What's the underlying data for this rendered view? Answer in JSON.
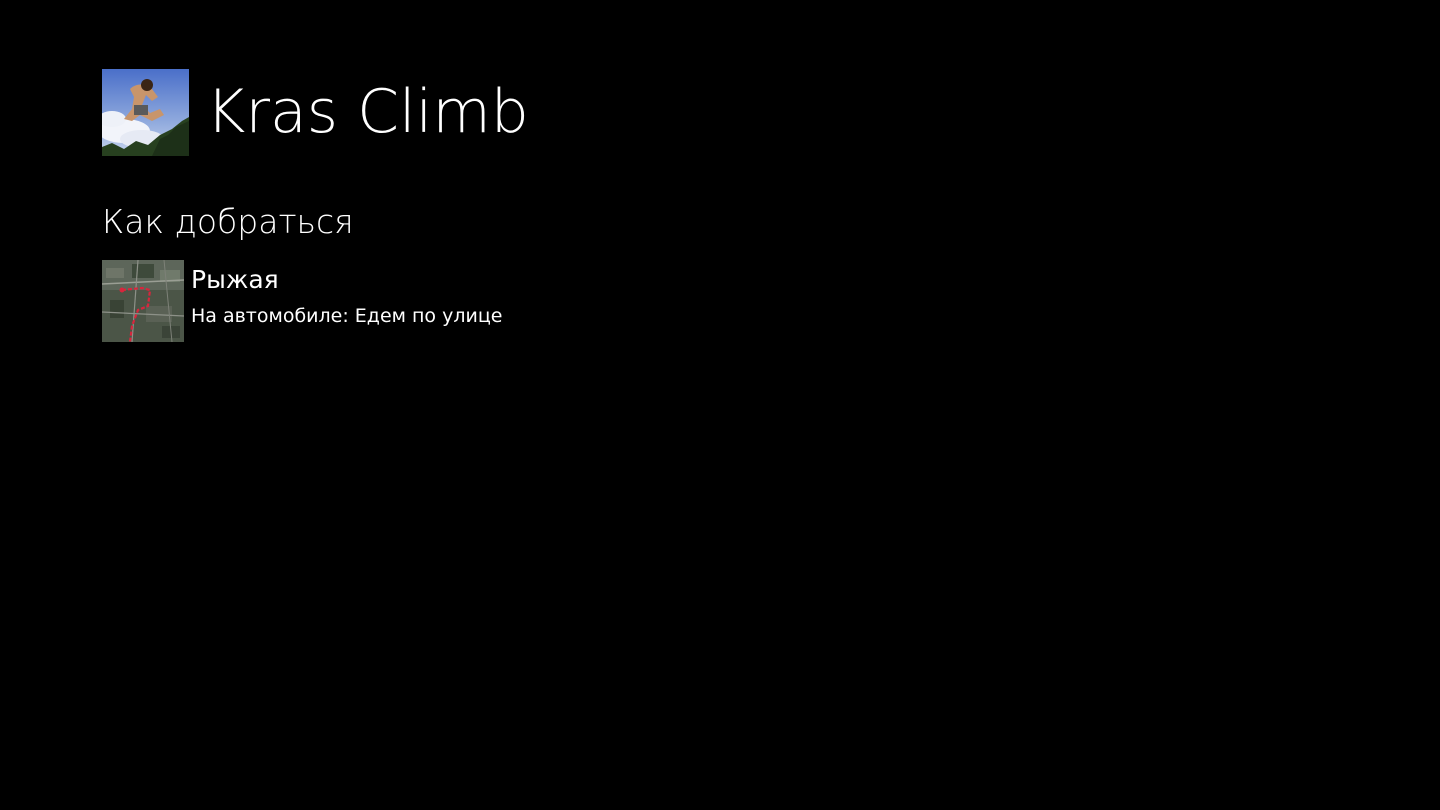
{
  "app": {
    "title": "Kras Climb",
    "logo_icon": "climber-photo-icon",
    "background": "#000000",
    "text_color": "#ffffff"
  },
  "section": {
    "title": "Как добраться"
  },
  "items": [
    {
      "title": "Рыжая",
      "subtitle": "На автомобиле: Едем по улице",
      "thumbnail_icon": "route-map-thumbnail-icon",
      "route_color": "#d7263d"
    }
  ]
}
